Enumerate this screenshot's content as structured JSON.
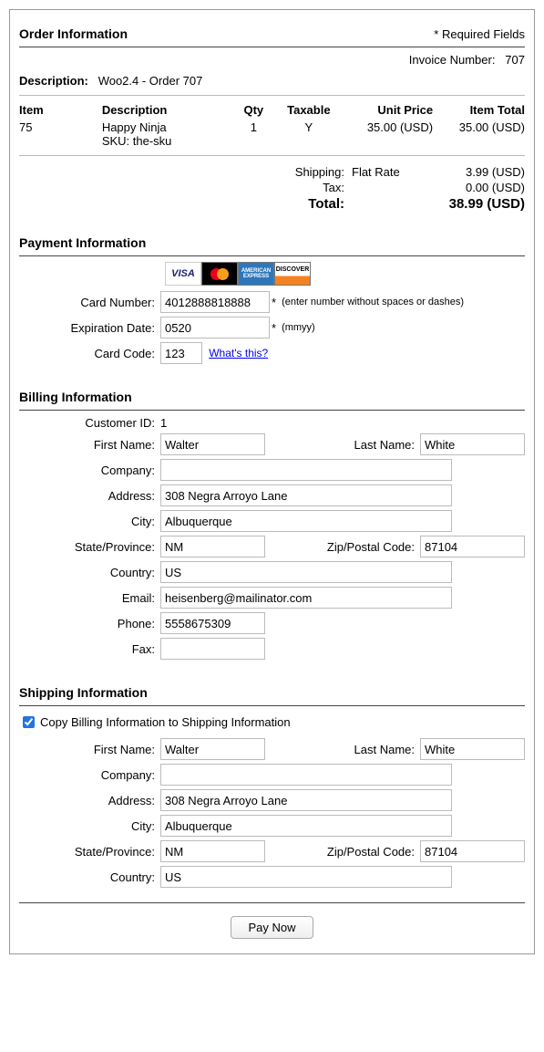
{
  "order": {
    "section_title": "Order Information",
    "required_label": "* Required Fields",
    "invoice_label": "Invoice Number:",
    "invoice_number": "707",
    "description_label": "Description:",
    "description_value": "Woo2.4 - Order 707",
    "headers": {
      "item": "Item",
      "desc": "Description",
      "qty": "Qty",
      "tax": "Taxable",
      "unit": "Unit Price",
      "total": "Item Total"
    },
    "rows": [
      {
        "item": "75",
        "desc": "Happy Ninja",
        "sku_label": "SKU:",
        "sku": "the-sku",
        "qty": "1",
        "taxable": "Y",
        "unit": "35.00 (USD)",
        "total": "35.00 (USD)"
      }
    ],
    "totals": {
      "shipping_label": "Shipping:",
      "shipping_method": "Flat Rate",
      "shipping_value": "3.99 (USD)",
      "tax_label": "Tax:",
      "tax_value": "0.00 (USD)",
      "total_label": "Total:",
      "total_value": "38.99 (USD)"
    }
  },
  "payment": {
    "section_title": "Payment Information",
    "card_number_label": "Card Number:",
    "card_number": "4012888818888",
    "card_number_hint": "(enter number without spaces or dashes)",
    "exp_label": "Expiration Date:",
    "exp_value": "0520",
    "exp_hint": "(mmyy)",
    "code_label": "Card Code:",
    "code_value": "123",
    "whats_this": "What's this?",
    "star": "*"
  },
  "billing": {
    "section_title": "Billing Information",
    "customer_id_label": "Customer ID:",
    "customer_id": "1",
    "first_name_label": "First Name:",
    "first_name": "Walter",
    "last_name_label": "Last Name:",
    "last_name": "White",
    "company_label": "Company:",
    "company": "",
    "address_label": "Address:",
    "address": "308 Negra Arroyo Lane",
    "city_label": "City:",
    "city": "Albuquerque",
    "state_label": "State/Province:",
    "state": "NM",
    "zip_label": "Zip/Postal Code:",
    "zip": "87104",
    "country_label": "Country:",
    "country": "US",
    "email_label": "Email:",
    "email": "heisenberg@mailinator.com",
    "phone_label": "Phone:",
    "phone": "5558675309",
    "fax_label": "Fax:",
    "fax": ""
  },
  "shipping": {
    "section_title": "Shipping Information",
    "copy_label": "Copy Billing Information to Shipping Information",
    "first_name_label": "First Name:",
    "first_name": "Walter",
    "last_name_label": "Last Name:",
    "last_name": "White",
    "company_label": "Company:",
    "company": "",
    "address_label": "Address:",
    "address": "308 Negra Arroyo Lane",
    "city_label": "City:",
    "city": "Albuquerque",
    "state_label": "State/Province:",
    "state": "NM",
    "zip_label": "Zip/Postal Code:",
    "zip": "87104",
    "country_label": "Country:",
    "country": "US"
  },
  "actions": {
    "pay_now": "Pay Now"
  }
}
